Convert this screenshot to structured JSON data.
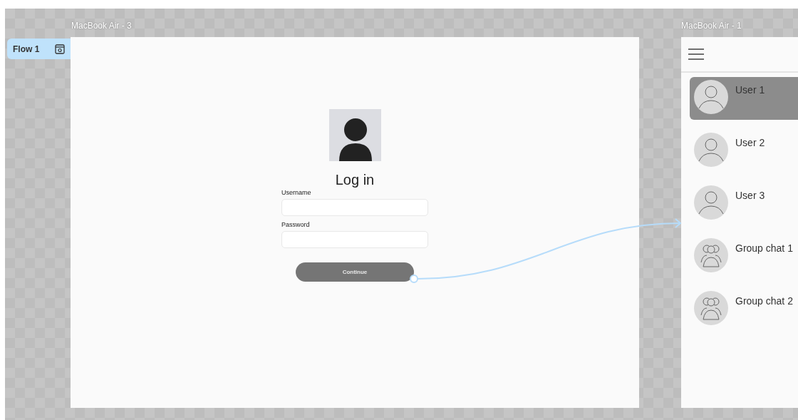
{
  "login_frame": {
    "title": "MacBook Air - 3",
    "flow_label": "Flow 1",
    "heading": "Log in",
    "fields": [
      {
        "label": "Username"
      },
      {
        "label": "Password"
      }
    ],
    "button": "Continue"
  },
  "chat_frame": {
    "title": "MacBook Air - 1",
    "chats": [
      {
        "name": "User 1",
        "kind": "user",
        "selected": true
      },
      {
        "name": "User 2",
        "kind": "user",
        "selected": false
      },
      {
        "name": "User 3",
        "kind": "user",
        "selected": false
      },
      {
        "name": "Group chat 1",
        "kind": "group",
        "selected": false
      },
      {
        "name": "Group chat 2",
        "kind": "group",
        "selected": false
      }
    ]
  }
}
